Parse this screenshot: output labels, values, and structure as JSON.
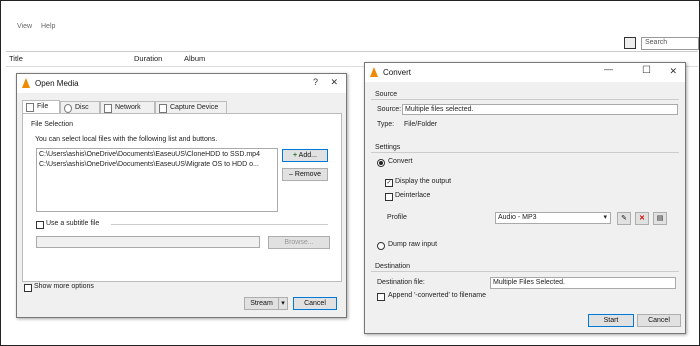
{
  "main": {
    "menu": {
      "item1": "View",
      "item2": "Help"
    },
    "search_placeholder": "Search",
    "playlist_columns": [
      "Title",
      "Duration",
      "Album"
    ]
  },
  "open_media": {
    "title": "Open Media",
    "tabs": [
      "File",
      "Disc",
      "Network",
      "Capture Device"
    ],
    "file_selection_title": "File Selection",
    "file_selection_desc": "You can select local files with the following list and buttons.",
    "files": [
      "C:\\Users\\ashis\\OneDrive\\Documents\\EaseuUS\\CloneHDD to SSD.mp4",
      "C:\\Users\\ashis\\OneDrive\\Documents\\EaseuUS\\Migrate OS to HDD o..."
    ],
    "add_label": "Add...",
    "remove_label": "Remove",
    "subtitle_label": "Use a subtitle file",
    "browse_label": "Browse...",
    "show_more_label": "Show more options",
    "stream_label": "Stream",
    "cancel_label": "Cancel"
  },
  "convert": {
    "title": "Convert",
    "source_title": "Source",
    "source_label": "Source:",
    "source_value": "Multiple files selected.",
    "type_label": "Type:",
    "type_value": "File/Folder",
    "settings_title": "Settings",
    "convert_label": "Convert",
    "display_output_label": "Display the output",
    "deinterlace_label": "Deinterlace",
    "profile_label": "Profile",
    "profile_value": "Audio - MP3",
    "dump_raw_label": "Dump raw input",
    "destination_title": "Destination",
    "dest_file_label": "Destination file:",
    "dest_file_value": "Multiple Files Selected.",
    "append_label": "Append '-converted' to filename",
    "start_label": "Start",
    "cancel_label": "Cancel"
  },
  "colors": {
    "vlc_orange": "#f08a00",
    "focus_blue": "#0078d7",
    "delete_red": "#d00000"
  }
}
